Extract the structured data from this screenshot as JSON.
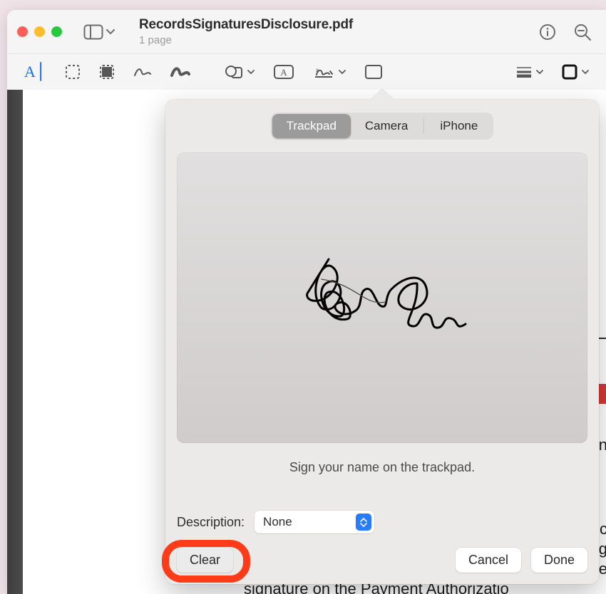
{
  "header": {
    "title": "RecordsSignaturesDisclosure.pdf",
    "subtitle": "1 page"
  },
  "toolbar": {
    "text_tool": "A",
    "textbox_label": "A"
  },
  "popover": {
    "tabs": {
      "trackpad": "Trackpad",
      "camera": "Camera",
      "iphone": "iPhone"
    },
    "hint": "Sign your name on the trackpad.",
    "description_label": "Description:",
    "description_value": "None",
    "clear_label": "Clear",
    "cancel_label": "Cancel",
    "done_label": "Done"
  },
  "page": {
    "background_text": "signature on the Payment Authorizatio",
    "side_n": "n",
    "side_c": "c",
    "side_g": "g",
    "side_e": "e"
  }
}
